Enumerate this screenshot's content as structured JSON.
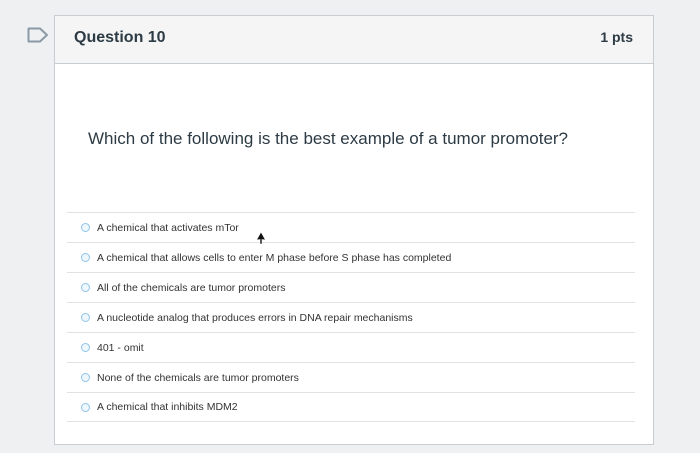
{
  "question": {
    "title": "Question 10",
    "points": "1 pts",
    "text": "Which of the following is the best example of a tumor promoter?"
  },
  "answers": [
    {
      "label": "A chemical that activates mTor"
    },
    {
      "label": "A chemical that allows cells to enter M phase before S phase has completed"
    },
    {
      "label": "All of the chemicals are tumor promoters"
    },
    {
      "label": "A nucleotide analog that produces errors in DNA repair mechanisms"
    },
    {
      "label": "401 - omit"
    },
    {
      "label": "None of the chemicals are tumor promoters"
    },
    {
      "label": "A chemical that inhibits MDM2"
    }
  ],
  "icons": {
    "flag": "flag-icon",
    "cursor": "mouse-cursor-icon"
  },
  "colors": {
    "flag": "#8b9aa6",
    "radio_border": "#8fc3e8",
    "text": "#2d3b45"
  }
}
